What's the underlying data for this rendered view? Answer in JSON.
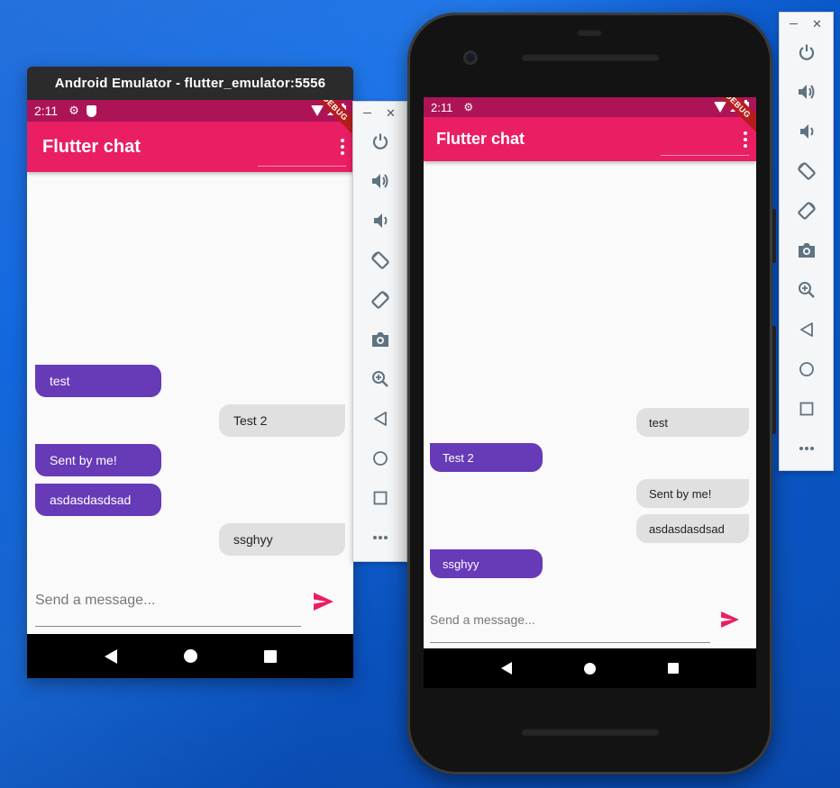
{
  "window1": {
    "title": "Android Emulator - flutter_emulator:5556",
    "status_time": "2:11",
    "app_title": "Flutter chat",
    "debug_banner": "DEBUG",
    "messages": [
      {
        "text": "test",
        "side": "mine"
      },
      {
        "text": "Test 2",
        "side": "other"
      },
      {
        "text": "Sent by me!",
        "side": "mine"
      },
      {
        "text": "asdasdasdsad",
        "side": "mine"
      },
      {
        "text": "ssghyy",
        "side": "other"
      }
    ],
    "input_placeholder": "Send a message..."
  },
  "window2": {
    "status_time": "2:11",
    "app_title": "Flutter chat",
    "debug_banner": "DEBUG",
    "messages": [
      {
        "text": "test",
        "side": "other"
      },
      {
        "text": "Test 2",
        "side": "mine"
      },
      {
        "text": "Sent by me!",
        "side": "other"
      },
      {
        "text": "asdasdasdsad",
        "side": "other"
      },
      {
        "text": "ssghyy",
        "side": "mine"
      }
    ],
    "input_placeholder": "Send a message..."
  },
  "toolbar_buttons": [
    "power-icon",
    "volume-up-icon",
    "volume-down-icon",
    "rotate-left-icon",
    "rotate-right-icon",
    "camera-icon",
    "zoom-icon",
    "back-icon",
    "home-icon",
    "overview-icon",
    "more-icon"
  ],
  "colors": {
    "app_bar": "#e91e63",
    "status_bar": "#ad1457",
    "my_bubble": "#673ab7",
    "other_bubble": "#e0e0e0",
    "send_icon": "#e91e63",
    "desktop": "#1a73e8"
  }
}
